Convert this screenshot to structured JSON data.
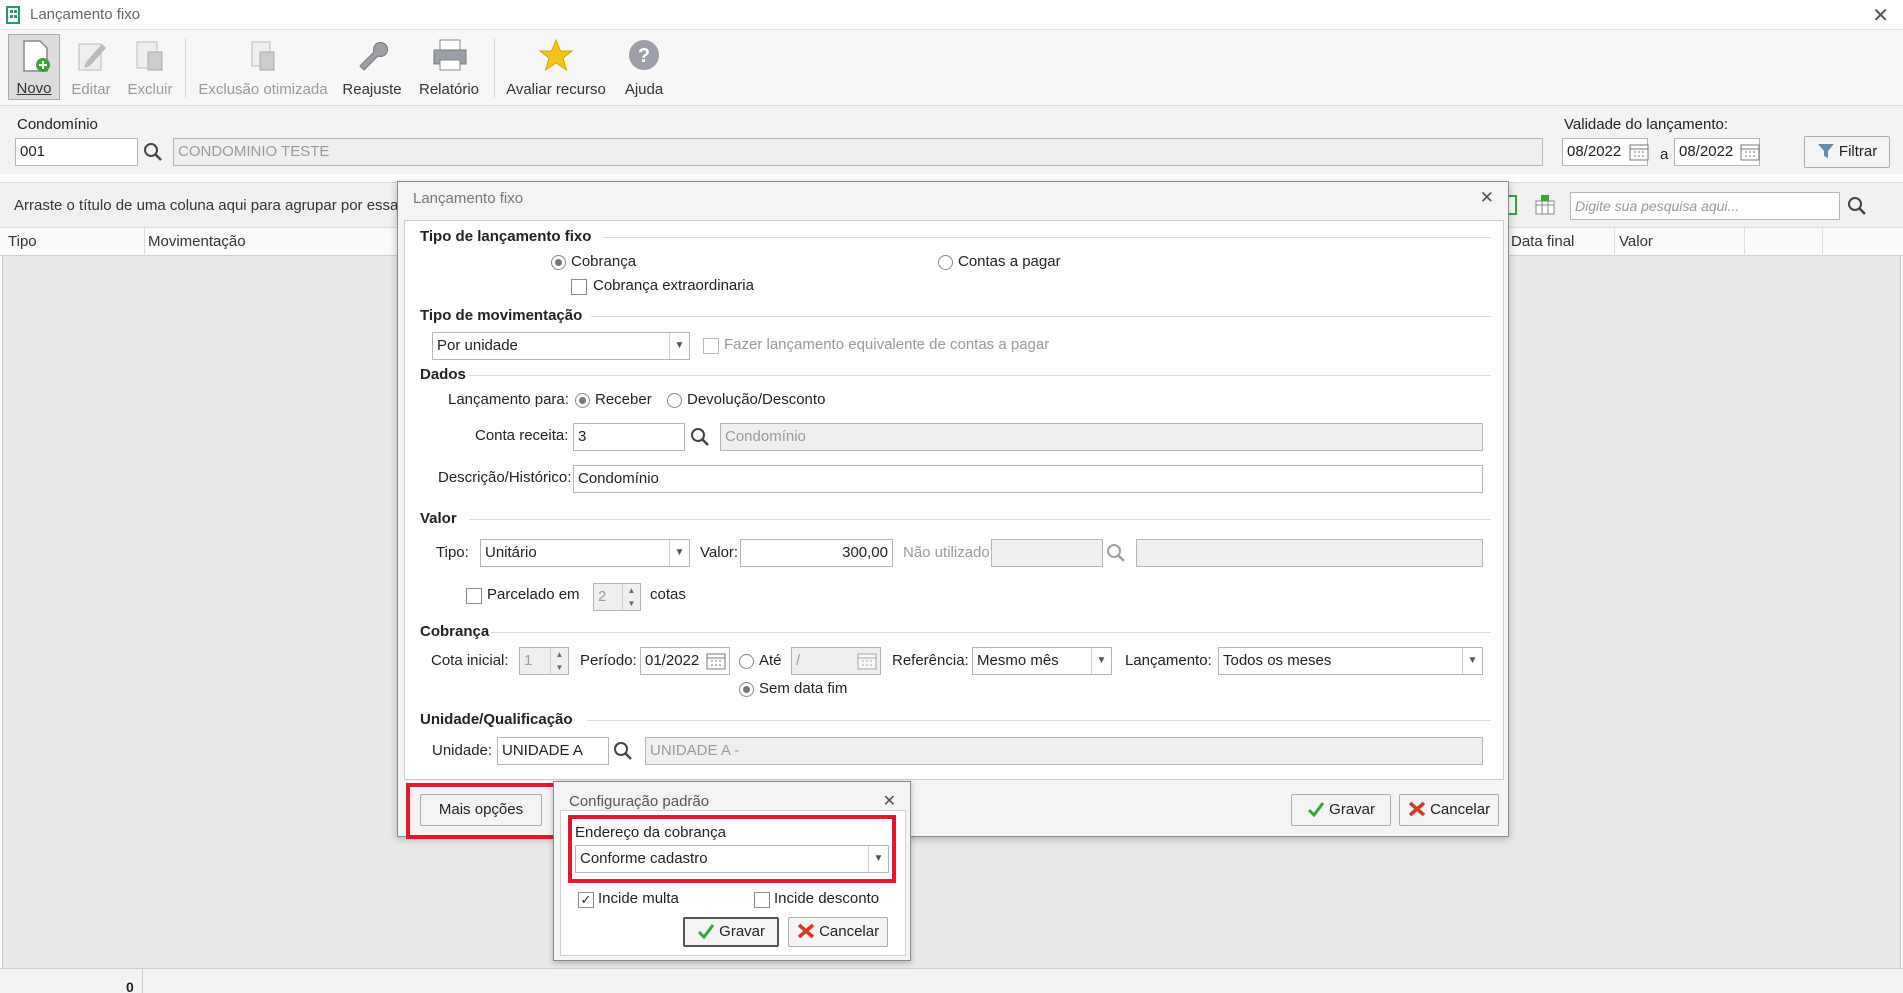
{
  "window": {
    "title": "Lançamento fixo"
  },
  "toolbar": {
    "novo": "Novo",
    "editar": "Editar",
    "excluir": "Excluir",
    "exclusao_otimizada": "Exclusão otimizada",
    "reajuste": "Reajuste",
    "relatorio": "Relatório",
    "avaliar": "Avaliar recurso",
    "ajuda": "Ajuda"
  },
  "filter": {
    "condominio_label": "Condomínio",
    "condominio_code": "001",
    "condominio_name": "CONDOMINIO TESTE",
    "validade_label": "Validade do lançamento:",
    "date_from": "08/2022",
    "sep": "a",
    "date_to": "08/2022",
    "filtrar": "Filtrar"
  },
  "grid": {
    "group_hint": "Arraste o título de uma coluna aqui para agrupar por essa c",
    "search_placeholder": "Digite sua pesquisa aqui...",
    "columns": [
      "Tipo",
      "Movimentação",
      "Data final",
      "Valor"
    ],
    "footer_count": "0"
  },
  "dialog": {
    "title": "Lançamento fixo",
    "tipo_section": "Tipo de lançamento fixo",
    "cobranca": "Cobrança",
    "contas_pagar": "Contas a pagar",
    "cobranca_extra": "Cobrança extraordinaria",
    "mov_section": "Tipo de movimentação",
    "mov_value": "Por unidade",
    "fazer_lanc": "Fazer lançamento equivalente de contas a pagar",
    "dados_section": "Dados",
    "lanc_para": "Lançamento para:",
    "receber": "Receber",
    "devolucao": "Devolução/Desconto",
    "conta_receita_label": "Conta receita:",
    "conta_receita_code": "3",
    "conta_receita_name": "Condomínio",
    "descricao_label": "Descrição/Histórico:",
    "descricao_value": "Condomínio",
    "valor_section": "Valor",
    "tipo_label": "Tipo:",
    "tipo_value": "Unitário",
    "valor_label": "Valor:",
    "valor_value": "300,00",
    "nao_utilizado": "Não utilizado:",
    "parcelado_em": "Parcelado em",
    "parcelas": "2",
    "cotas": "cotas",
    "cobranca_section": "Cobrança",
    "cota_inicial_label": "Cota inicial:",
    "cota_inicial": "1",
    "periodo_label": "Período:",
    "periodo_value": "01/2022",
    "ate": "Até",
    "ate_value": "/",
    "sem_data_fim": "Sem data fim",
    "referencia_label": "Referência:",
    "referencia_value": "Mesmo mês",
    "lancamento_label": "Lançamento:",
    "lancamento_value": "Todos os meses",
    "unidade_section": "Unidade/Qualificação",
    "unidade_label": "Unidade:",
    "unidade_code": "UNIDADE A",
    "unidade_name": "UNIDADE A -",
    "mais_opcoes": "Mais opções",
    "gravar": "Gravar",
    "cancelar": "Cancelar"
  },
  "popup": {
    "title": "Configuração padrão",
    "endereco_label": "Endereço da cobrança",
    "endereco_value": "Conforme cadastro",
    "incide_multa": "Incide multa",
    "incide_desconto": "Incide desconto",
    "gravar": "Gravar",
    "cancelar": "Cancelar"
  },
  "colors": {
    "highlight": "#e0192c",
    "check_green": "#3aa33a",
    "cancel_red": "#d9391f",
    "star": "#f2c318"
  }
}
